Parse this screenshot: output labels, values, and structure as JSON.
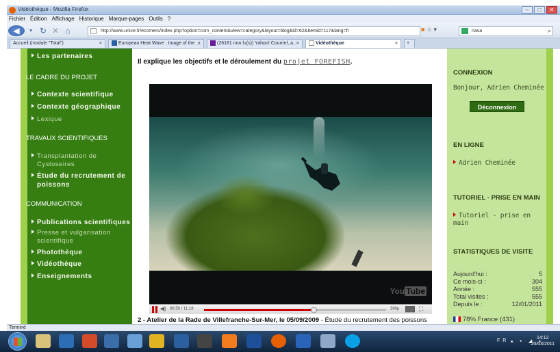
{
  "window": {
    "title": "Vidéothèque - Mozilla Firefox",
    "controls": [
      "–",
      "□",
      "✕"
    ]
  },
  "menu": [
    "Fichier",
    "Édition",
    "Affichage",
    "Historique",
    "Marque-pages",
    "Outils",
    "?"
  ],
  "nav": {
    "url": "http://www.unice.fr/ecomers/index.php?option=com_content&view=category&layout=blog&id=62&Itemid=117&lang=fr",
    "search_value": "nasa"
  },
  "tabs": [
    {
      "label": "Accueil (module \"Total\")",
      "active": false
    },
    {
      "label": "European Heat Wave : Image of the ...",
      "active": false
    },
    {
      "label": "(26181 non lu(s)) Yahoo! Courriel, a...",
      "active": false
    },
    {
      "label": "Vidéothèque",
      "active": true
    }
  ],
  "sidebar": {
    "items": [
      {
        "label": "Les partenaires"
      },
      {
        "heading": "LE CADRE DU PROJET"
      },
      {
        "label": "Contexte scientifique"
      },
      {
        "label": "Contexte géographique"
      },
      {
        "label": "Lexique"
      },
      {
        "heading": "TRAVAUX SCIENTIFIQUES"
      },
      {
        "label_line1": "Transplantation de",
        "label_line2": "Cystoseires"
      },
      {
        "label_line1": "Étude du recrutement de",
        "label_line2": "poissons"
      },
      {
        "heading": "COMMUNICATION"
      },
      {
        "label": "Publications scientifiques"
      },
      {
        "label_line1": "Presse et vulgarisation",
        "label_line2": "scientifique"
      },
      {
        "label": "Photothèque"
      },
      {
        "label": "Vidéothèque"
      },
      {
        "label": "Enseignements"
      }
    ]
  },
  "main": {
    "intro_text": "Il explique les objectifs et le déroulement du",
    "intro_link": "projet FOREFISH",
    "intro_end": ".",
    "video": {
      "time": "06:50 / 11:18",
      "progress": 0.6,
      "quality": "360p",
      "watermark_a": "You",
      "watermark_b": "Tube"
    },
    "caption_bold": "2 - Atelier de la Rade de Villefranche-Sur-Mer, le 05/09/2009",
    "caption_rest": " - Étude du recrutement des poissons"
  },
  "rightbar": {
    "connexion_heading": "CONNEXION",
    "greeting": "Bonjour, Adrien Cheminée",
    "logout_label": "Déconnexion",
    "online_heading": "EN LIGNE",
    "online_user": "Adrien Cheminée",
    "tutorial_heading": "TUTORIEL - PRISE EN MAIN",
    "tutorial_link": "Tutoriel - prise en main",
    "stats_heading": "STATISTIQUES DE VISITE",
    "stats": [
      {
        "label": "Aujourd'hui :",
        "value": "5"
      },
      {
        "label": "Ce mois-ci :",
        "value": "304"
      },
      {
        "label": "Année :",
        "value": "555"
      },
      {
        "label": "Total visites :",
        "value": "555"
      },
      {
        "label": "Depuis le :",
        "value": "12/01/2011"
      }
    ],
    "country": "78% France (431)"
  },
  "status_text": "Terminé",
  "taskbar": {
    "lang": "FR",
    "time": "14:12",
    "date": "20/03/2011"
  }
}
